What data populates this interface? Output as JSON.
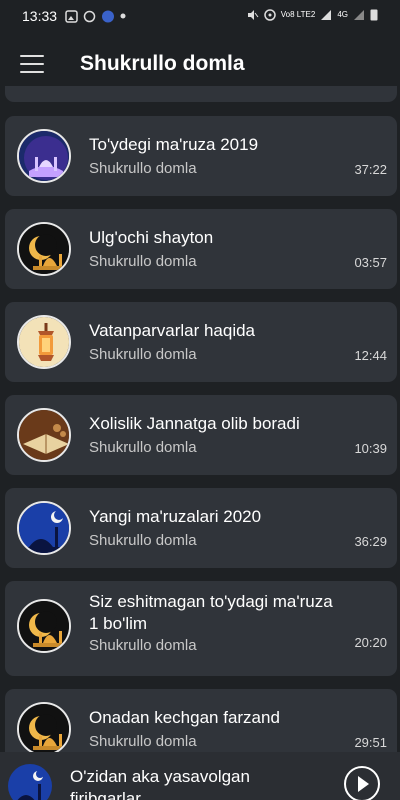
{
  "status": {
    "time": "13:33",
    "net": "Vo8 LTE2",
    "signal": "4G"
  },
  "appbar": {
    "title": "Shukrullo domla"
  },
  "tracks": [
    {
      "title": "To'ydegi ma'ruza 2019",
      "artist": "Shukrullo domla",
      "duration": "37:22",
      "thumb": "mosque-night-icon"
    },
    {
      "title": "Ulg'ochi shayton",
      "artist": "Shukrullo domla",
      "duration": "03:57",
      "thumb": "crescent-mosque-icon"
    },
    {
      "title": "Vatanparvarlar haqida",
      "artist": "Shukrullo domla",
      "duration": "12:44",
      "thumb": "lantern-icon"
    },
    {
      "title": "Xolislik Jannatga olib boradi",
      "artist": "Shukrullo domla",
      "duration": "10:39",
      "thumb": "quran-book-icon"
    },
    {
      "title": "Yangi ma'ruzalari 2020",
      "artist": "Shukrullo domla",
      "duration": "36:29",
      "thumb": "mosque-moon-icon"
    },
    {
      "title": "Siz eshitmagan to'ydagi ma'ruza 1 bo'lim",
      "artist": "Shukrullo domla",
      "duration": "20:20",
      "thumb": "crescent-mosque-icon"
    },
    {
      "title": "Onadan kechgan farzand",
      "artist": "Shukrullo domla",
      "duration": "29:51",
      "thumb": "crescent-mosque-icon"
    }
  ],
  "player": {
    "title": "O'zidan aka yasavolgan firibgarlar"
  }
}
